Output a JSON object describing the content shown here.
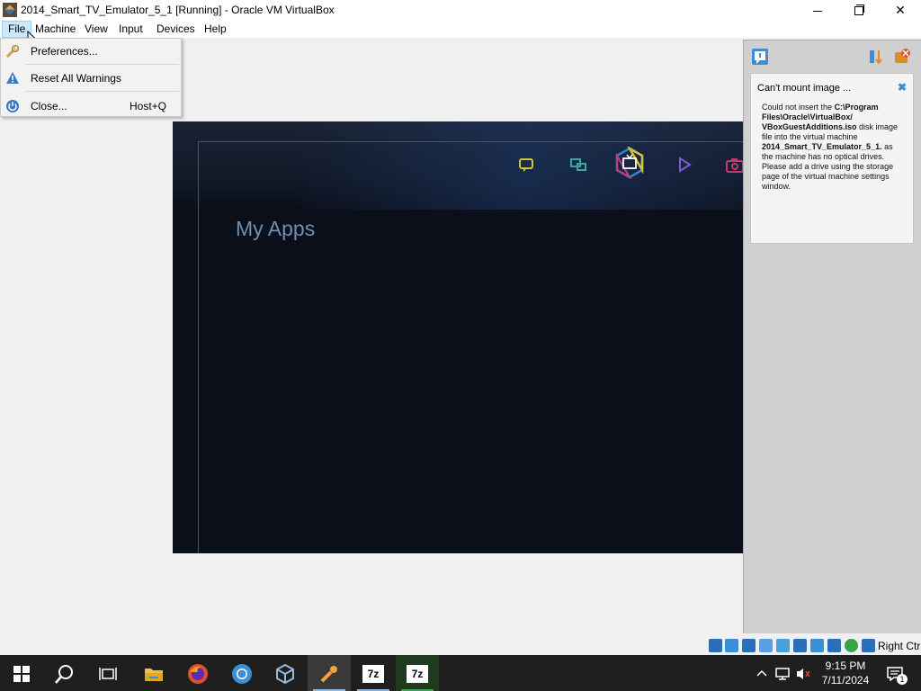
{
  "window": {
    "title": "2014_Smart_TV_Emulator_5_1 [Running] - Oracle VM VirtualBox",
    "min_glyph": "",
    "close_glyph": "✕"
  },
  "menubar": {
    "items": [
      "File",
      "Machine",
      "View",
      "Input",
      "Devices",
      "Help"
    ],
    "active": "File"
  },
  "file_menu": {
    "items": [
      {
        "label": "Preferences...",
        "shortcut": "",
        "icon": "wrench-icon"
      },
      {
        "label": "Reset All Warnings",
        "shortcut": "",
        "icon": "warning-icon"
      },
      {
        "label": "Close...",
        "shortcut": "Host+Q",
        "icon": "power-icon"
      }
    ]
  },
  "vm": {
    "heading": "My Apps",
    "nav_icons": [
      "chat-icon",
      "screen-mirror-icon",
      "tv-icon",
      "play-icon",
      "camera-icon"
    ]
  },
  "notification": {
    "title": "Can't mount image ...",
    "close_glyph": "✖",
    "body_parts": {
      "p1": "Could not insert the ",
      "path": "C:\\Program Files\\Oracle\\VirtualBox/ VBoxGuestAdditions.iso",
      "p2": " disk image file into the virtual machine ",
      "vm_name": "2014_Smart_TV_Emulator_5_1.",
      "p3": " as the machine has no optical drives. Please add a drive using the storage page of the virtual machine settings window."
    }
  },
  "statusbar": {
    "host_key": "Right Ctrl"
  },
  "taskbar": {
    "apps": [
      "start-button",
      "search-button",
      "task-view-button",
      "file-explorer",
      "firefox",
      "chrome",
      "virtualbox-manager",
      "virtualbox-vm",
      "7zip-1",
      "7zip-2"
    ],
    "seven_zip_label": "7z",
    "time": "9:15 PM",
    "date": "7/11/2024",
    "notification_count": "1"
  },
  "colors": {
    "menu_active_bg": "#cce8ff",
    "vm_bg": "#0b0f1a",
    "my_apps_text": "#6f8fb0",
    "taskbar_bg": "#1f1f1f"
  }
}
